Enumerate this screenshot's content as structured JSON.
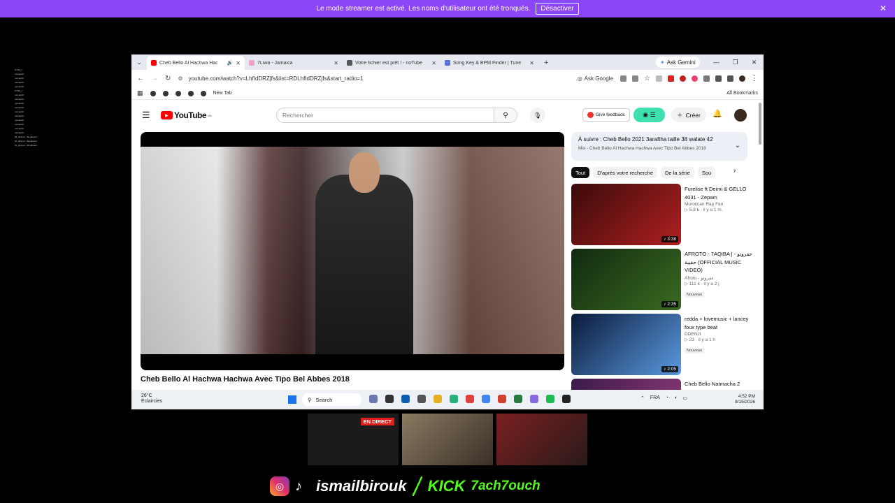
{
  "banner": {
    "message": "Le mode streamer est activé. Les noms d'utilisateur ont été tronqués.",
    "button_label": "Désactiver",
    "close_glyph": "✕"
  },
  "overlay_chat": {
    "lines": [
      "KYSA_f :",
      "notmar23 :",
      "notmar23 :",
      "notmar23 :",
      "notmar23 :",
      "KYSA_f :",
      "notmar23 :",
      "notmar23 :",
      "notmar23 :",
      "notmar23 :",
      "notmar23 :",
      "notmar23 :",
      "notmar23 :",
      "notmar23 :",
      "notmar23 :",
      "notmar23 :",
      "hit_dimmel : 49 élément",
      "hit_dimmel : 49 élément",
      "hit_dimmel : 49 élément"
    ]
  },
  "browser": {
    "tabs": [
      {
        "title": "Cheb Bello Al Hachwa Hac",
        "favicon_color": "#ff0000",
        "active": true
      },
      {
        "title": "7Liwa - Jamaica",
        "favicon_color": "#f0a0c0",
        "active": false
      },
      {
        "title": "Votre fichier est prêt ! - noTube",
        "favicon_color": "#555555",
        "active": false
      },
      {
        "title": "Song Key & BPM Finder | Tune",
        "favicon_color": "#5a6ee0",
        "active": false
      }
    ],
    "new_tab_glyph": "+",
    "ask_gemini": "Ask Gemini",
    "url": "youtube.com/watch?v=LhfIdDRZjfs&list=RDLhfIdDRZjfs&start_radio=1",
    "ask_google": "Ask Google",
    "bookmarks": {
      "new_tab": "New Tab",
      "all_bookmarks": "All Bookmarks"
    }
  },
  "youtube": {
    "logo_text": "YouTube",
    "logo_region": "MA",
    "search_placeholder": "Rechercher",
    "give_feedback": "Give feedback",
    "create_label": "Créer",
    "video_title": "Cheb Bello Al Hachwa Hachwa Avec Tipo Bel Abbes 2018",
    "up_next": {
      "title": "À suivre : Cheb Bello 2021 3araftha taille 38 walate 42",
      "subtitle": "Mix - Cheb Bello Al Hachwa Hachwa Avec Tipo Bel Abbes 2018"
    },
    "chips": [
      "Tout",
      "D'après votre recherche",
      "De la série",
      "Sou"
    ],
    "recommendations": [
      {
        "title": "Furelise ft Deimi & GELLO 4031 - Zepam",
        "channel": "Moroccan Rap Fan",
        "stats": "▷ 5,8 k · il y a 1 m.",
        "duration": "♪ 3:38",
        "badge": "",
        "thumb_colors": [
          "#3a0a0a",
          "#b02020"
        ]
      },
      {
        "title": "AFROTO - 7AQIBA | عفروتو - حقيبة (OFFICIAL MUSIC VIDEO)",
        "channel": "Afroto - عفروتو",
        "stats": "▷ 111 k · il y a 2 j",
        "duration": "♪ 2:35",
        "badge": "Nouveau",
        "thumb_colors": [
          "#102a10",
          "#3a6a20"
        ]
      },
      {
        "title": "redda + lovemusic + lancey foux type beat",
        "channel": "DDENJI",
        "stats": "▷ 23 · il y a 1 h",
        "duration": "♪ 2:05",
        "badge": "Nouveau",
        "thumb_colors": [
          "#0a1a3a",
          "#5a9ae0"
        ]
      },
      {
        "title": "Cheb Bello  Natmacha 2",
        "channel": "",
        "stats": "",
        "duration": "",
        "badge": "",
        "thumb_colors": [
          "#3a1a4a",
          "#a04080"
        ]
      }
    ]
  },
  "taskbar": {
    "weather_temp": "26°C",
    "weather_desc": "Éclaircies",
    "search_label": "Search",
    "language": "FRA",
    "time": "4:52 PM",
    "date": "8/15/2026",
    "app_colors": [
      "#6a7ab0",
      "#333333",
      "#0a5fb0",
      "#555555",
      "#e8b020",
      "#2ab07a",
      "#e04040",
      "#4285f4",
      "#d04030",
      "#2a7a40",
      "#8a6ae0",
      "#1db954",
      "#222222"
    ]
  },
  "stream": {
    "live_label": "EN DIRECT",
    "handle": "ismailbirouk",
    "kick_label": "KICK",
    "kick_handle": "7ach7ouch"
  },
  "colors": {
    "banner_bg": "#8c45f7",
    "youtube_red": "#ff0000",
    "kick_green": "#53fc18"
  }
}
